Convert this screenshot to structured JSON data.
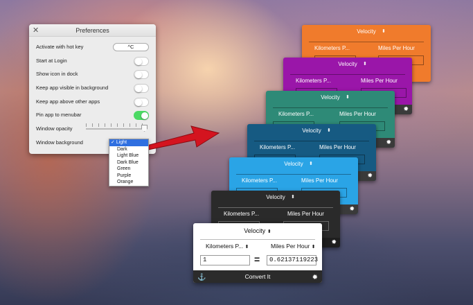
{
  "preferences": {
    "title": "Preferences",
    "rows": [
      {
        "label": "Activate with hot key",
        "type": "hotkey",
        "value": "^C"
      },
      {
        "label": "Start at Login",
        "type": "toggle",
        "on": false
      },
      {
        "label": "Show icon in dock",
        "type": "toggle",
        "on": false
      },
      {
        "label": "Keep app visible in background",
        "type": "toggle",
        "on": false
      },
      {
        "label": "Keep app above other apps",
        "type": "toggle",
        "on": false
      },
      {
        "label": "Pin app to menubar",
        "type": "toggle",
        "on": true
      },
      {
        "label": "Window opacity",
        "type": "slider"
      },
      {
        "label": "Window background",
        "type": "select"
      }
    ],
    "background_options": [
      "Light",
      "Dark",
      "Light Blue",
      "Dark Blue",
      "Green",
      "Purple",
      "Orange"
    ],
    "selected_background": "Light",
    "selected_mark": "✓"
  },
  "converter": {
    "category": "Velocity",
    "from_unit": "Kilometers P...",
    "to_unit": "Miles Per Hour",
    "input_value": "1",
    "equals": "=",
    "result_value": "0.62137119223",
    "convert_label": "Convert It",
    "anchor_icon": "anchor-icon",
    "gear_icon": "gear-icon"
  },
  "themes": [
    {
      "name": "Orange",
      "color": "#f07b2c"
    },
    {
      "name": "Purple",
      "color": "#9a16a9"
    },
    {
      "name": "Green",
      "color": "#2e8a77"
    },
    {
      "name": "Dark Blue",
      "color": "#165a82"
    },
    {
      "name": "Light Blue",
      "color": "#2aa4e6"
    },
    {
      "name": "Dark",
      "color": "#2a2a2a"
    }
  ],
  "arrow_color": "#d4141f"
}
